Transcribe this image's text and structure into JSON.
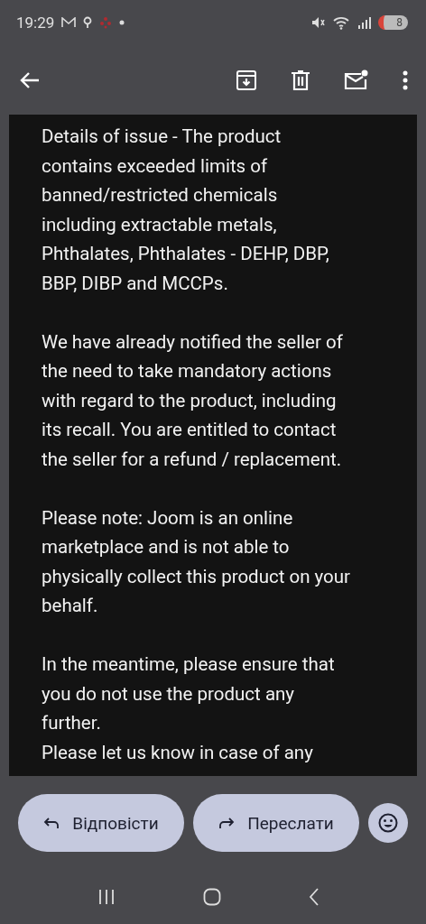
{
  "status_bar": {
    "time": "19:29",
    "battery": "8"
  },
  "message": {
    "paragraphs": [
      "Details of issue - The product\ncontains exceeded limits of\nbanned/restricted chemicals\nincluding extractable metals,\nPhthalates, Phthalates - DEHP, DBP,\nBBP, DIBP and MCCPs.",
      "We have already notified the seller of\nthe need to take mandatory actions\nwith regard to the product, including\nits recall. You are entitled to contact\nthe seller for a refund / replacement.",
      "Please note: Joom is an online\nmarketplace and is not able to\nphysically collect this product on your\nbehalf.",
      "In the meantime, please ensure that\nyou do not use the product any\nfurther.\nPlease let us know in case of any"
    ]
  },
  "actions": [
    {
      "kind": "reply",
      "label": "Відповісти"
    },
    {
      "kind": "forward",
      "label": "Переслати"
    }
  ]
}
